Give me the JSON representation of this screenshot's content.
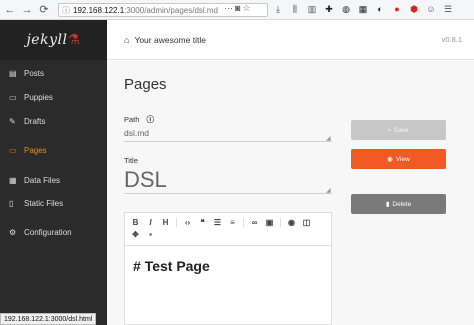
{
  "browser": {
    "url_host": "192.168.122.1",
    "url_path": ":3000/admin/pages/dsl.md",
    "nav": {
      "back": "←",
      "forward": "→",
      "reload": "⟳",
      "home": "⌂"
    },
    "address_actions": [
      "···",
      "☆",
      "★"
    ],
    "extensions": [
      "download-icon",
      "library-icon",
      "sidebar-icon",
      "puzzle-icon",
      "mask-icon",
      "grid-icon",
      "addon-icon",
      "addon-icon-2",
      "adblock-icon",
      "smile-icon",
      "menu-icon"
    ]
  },
  "sidebar": {
    "logo": "jekyll",
    "items": [
      {
        "label": "Posts",
        "icon": "posts-icon"
      },
      {
        "label": "Puppies",
        "icon": "folder-icon"
      },
      {
        "label": "Drafts",
        "icon": "edit-icon"
      },
      {
        "label": "Pages",
        "icon": "folder-icon"
      },
      {
        "label": "Data Files",
        "icon": "table-icon"
      },
      {
        "label": "Static Files",
        "icon": "file-icon"
      },
      {
        "label": "Configuration",
        "icon": "gear-icon"
      }
    ],
    "active": "Pages"
  },
  "header": {
    "title": "Your awesome title",
    "version": "v0.8.1"
  },
  "main": {
    "heading": "Pages",
    "path_label": "Path",
    "path_value": "dsl.md",
    "title_label": "Title",
    "title_value": "DSL",
    "editor_content": "# Test Page"
  },
  "buttons": {
    "save": "Save",
    "view": "View",
    "delete": "Delete"
  },
  "status": {
    "url": "192.168.122.1:3000/dsl.html"
  }
}
